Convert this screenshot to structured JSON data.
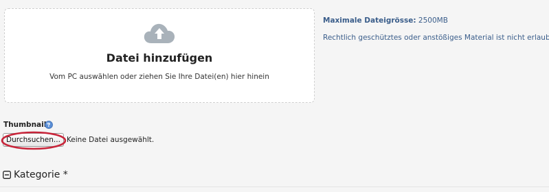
{
  "upload": {
    "title": "Datei hinzufügen",
    "subtitle": "Vom PC auswählen oder ziehen Sie Ihre Datei(en) hier hinein",
    "icon": "cloud-upload-icon"
  },
  "info": {
    "max_size_label": "Maximale Dateigrösse:",
    "max_size_value": "2500MB",
    "notice": "Rechtlich geschütztes oder anstößiges Material ist nicht erlaubt."
  },
  "thumbnail": {
    "label": "Thumbnail",
    "help_icon": "help-icon",
    "browse_label": "Durchsuchen...",
    "no_file_text": "Keine Datei ausgewählt."
  },
  "category": {
    "label": "Kategorie *",
    "icon": "collapse-minus-icon"
  },
  "colors": {
    "info_text": "#3a5d8a",
    "annotation_circle": "#c8253a",
    "cloud_icon": "#a9b2ba"
  }
}
